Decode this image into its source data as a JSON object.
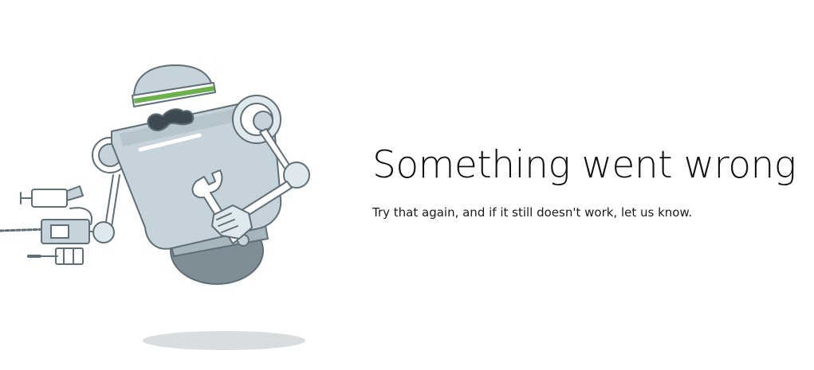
{
  "error": {
    "title": "Something went wrong",
    "message": "Try that again, and if it still doesn't work, let us know."
  },
  "illustration": {
    "name": "robot-with-wrench-illustration",
    "colors": {
      "outline": "#5f6f78",
      "body": "#c6d3da",
      "body_dark": "#8b9aa2",
      "headband": "#6ab04c",
      "mustache": "#3d4a52",
      "shadow": "#d9dde0"
    }
  }
}
